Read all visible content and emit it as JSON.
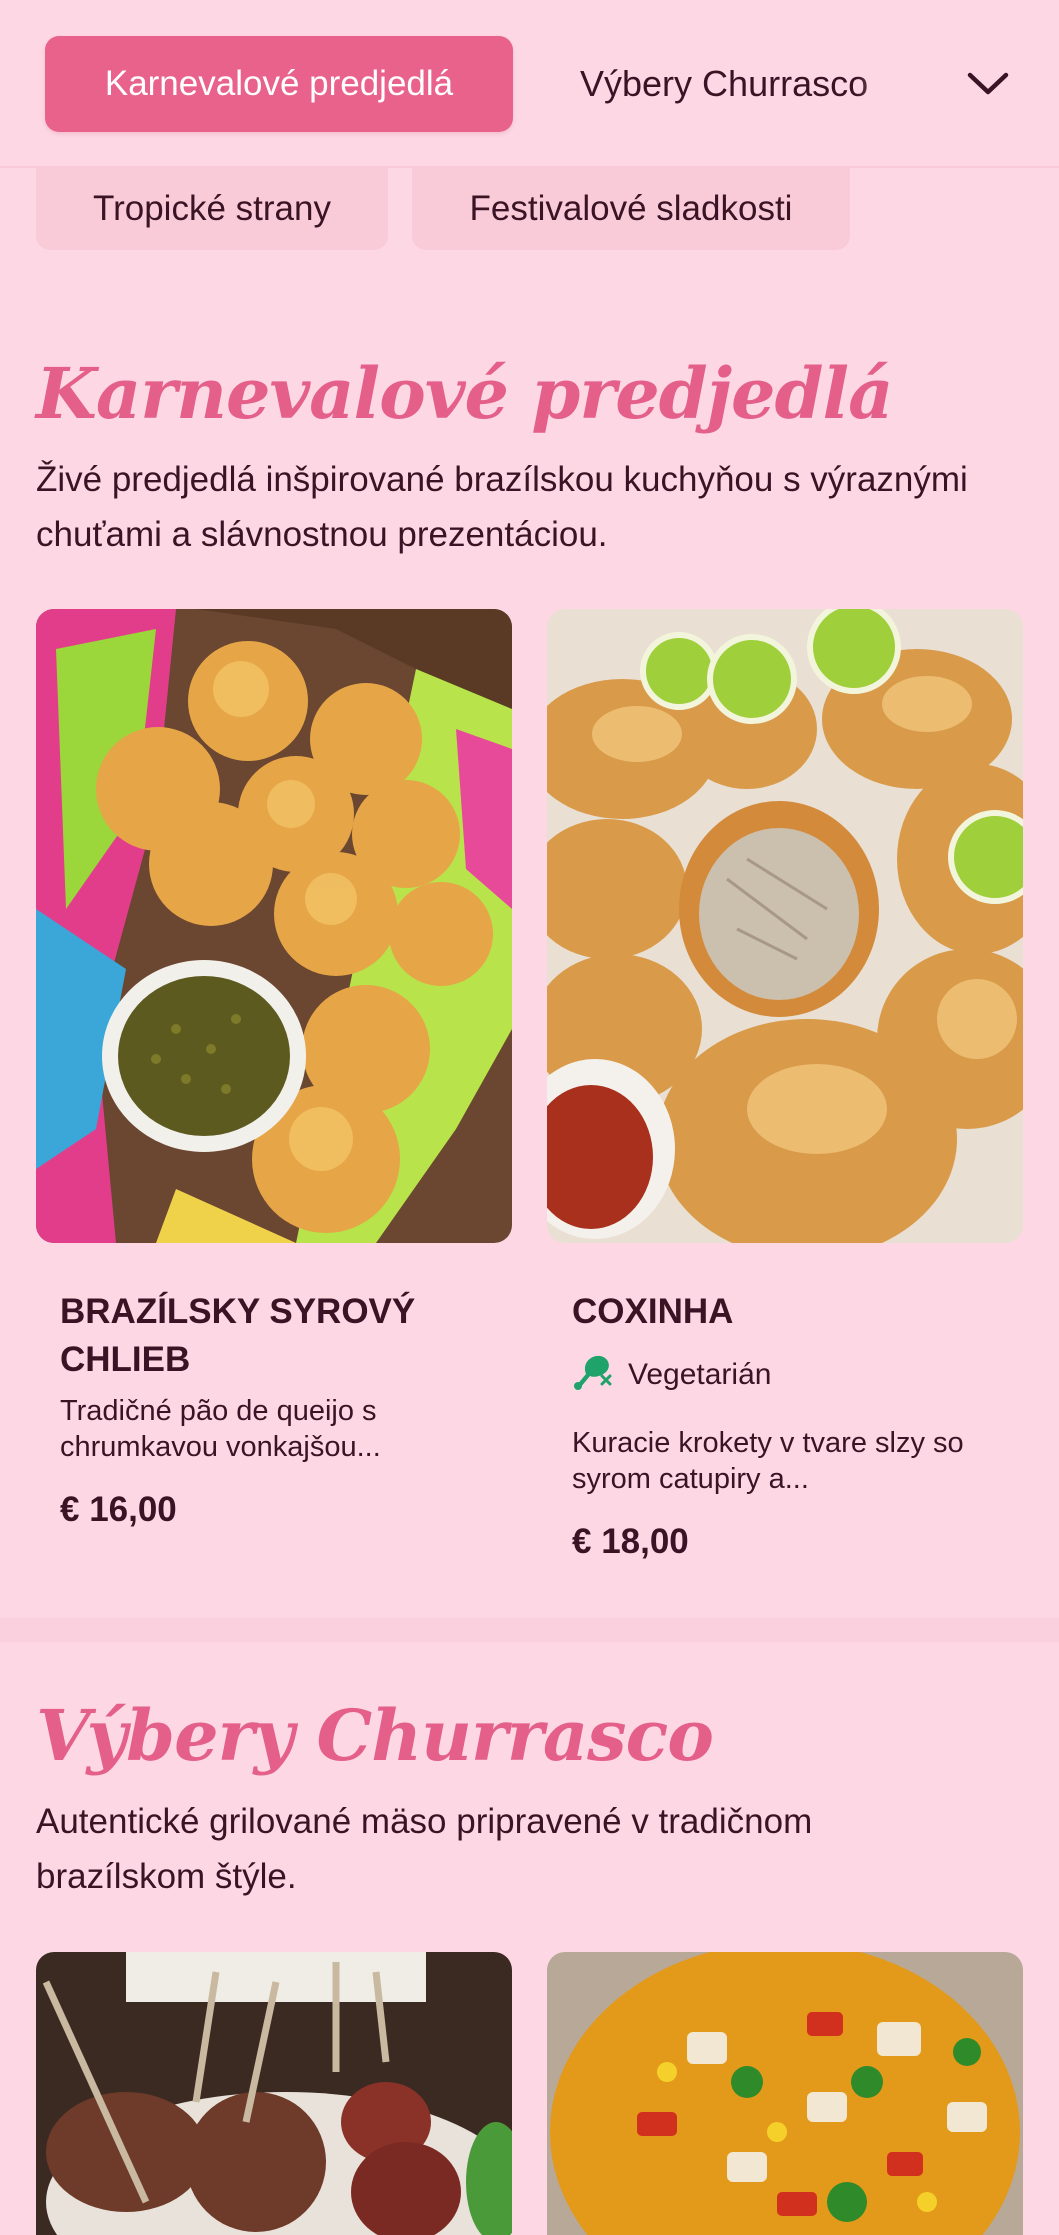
{
  "nav": {
    "tabs": [
      "Karnevalové predjedlá",
      "Výbery Churrasco",
      "Tropické strany",
      "Festivalové sladkosti"
    ],
    "active_tab": "Karnevalové predjedlá",
    "expand_icon": "chevron-down-icon"
  },
  "sections": [
    {
      "title": "Karnevalové predjedlá",
      "description": "Živé predjedlá inšpirované brazílskou kuchyňou s výraznými chuťami a slávnostnou prezentáciou.",
      "items": [
        {
          "name": "BRAZÍLSKY SYROVÝ CHLIEB",
          "description": "Tradičné pão de queijo s chrumkavou vonkajšou...",
          "price": "€ 16,00"
        },
        {
          "name": "COXINHA",
          "tag": "Vegetarián",
          "tag_icon": "vegetarian-drumstick-icon",
          "description": "Kuracie krokety v tvare slzy so syrom catupiry a...",
          "price": "€ 18,00"
        }
      ]
    },
    {
      "title": "Výbery Churrasco",
      "description": "Autentické grilované mäso pripravené v tradičnom brazílskom štýle."
    }
  ],
  "colors": {
    "background": "#fdd8e4",
    "accent": "#e8628b",
    "heading": "#e4608a",
    "text": "#3a1424",
    "veg_green": "#1fa36a"
  }
}
